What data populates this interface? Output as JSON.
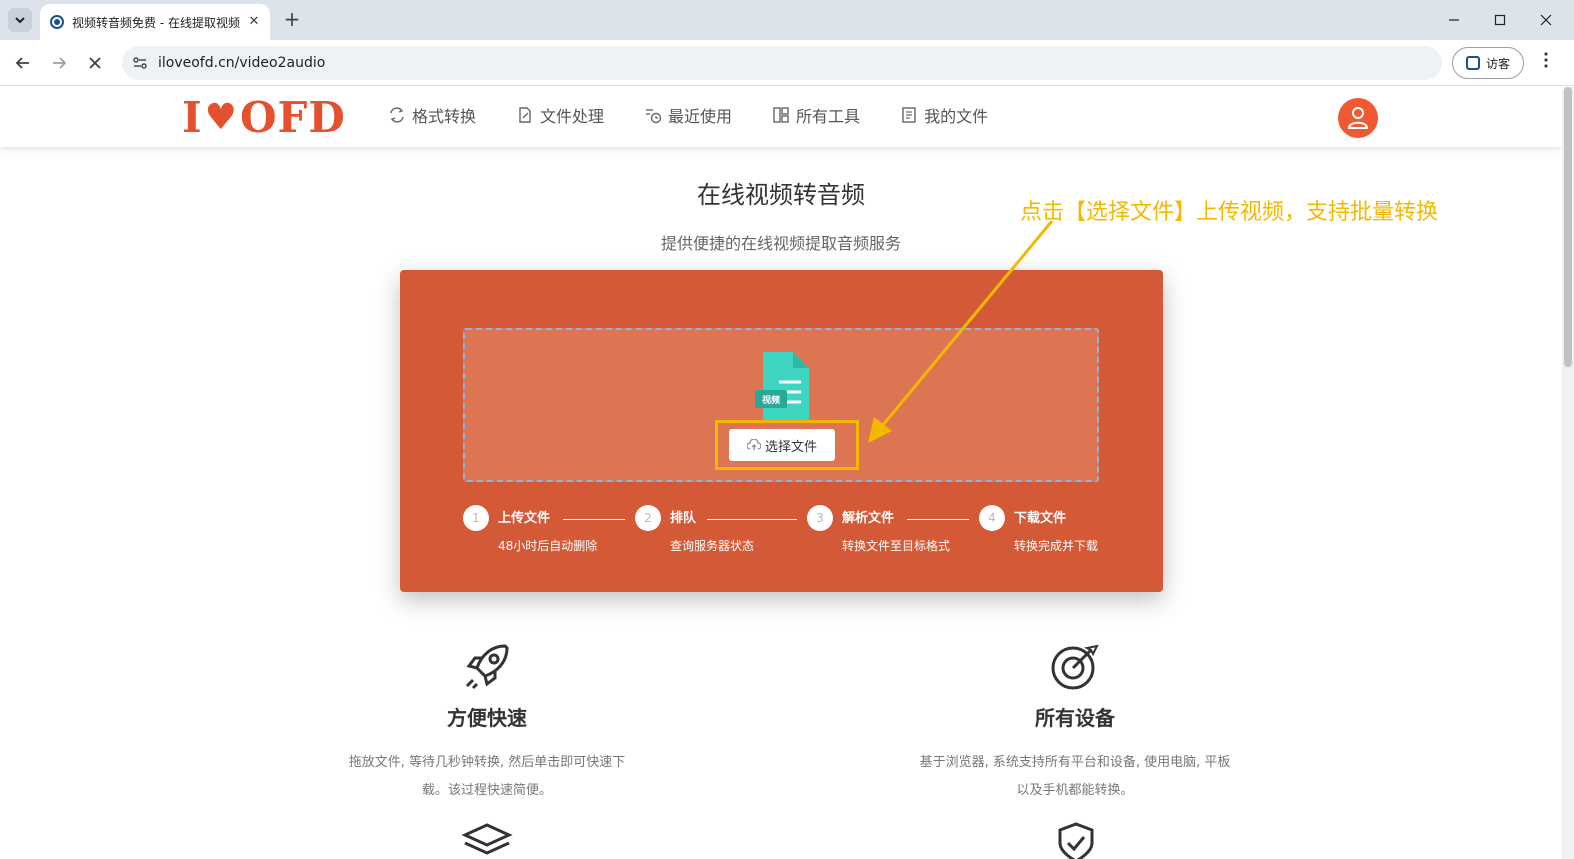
{
  "browser": {
    "tab_title": "视频转音频免费 - 在线提取视频",
    "url": "iloveofd.cn/video2audio",
    "guest_label": "访客"
  },
  "header": {
    "logo_left": "I",
    "logo_heart": "♥",
    "logo_right": "OFD",
    "nav": [
      {
        "label": "格式转换",
        "icon": "convert-icon"
      },
      {
        "label": "文件处理",
        "icon": "edit-file-icon"
      },
      {
        "label": "最近使用",
        "icon": "history-icon"
      },
      {
        "label": "所有工具",
        "icon": "grid-icon"
      },
      {
        "label": "我的文件",
        "icon": "document-icon"
      }
    ]
  },
  "hero": {
    "title": "在线视频转音频",
    "subtitle": "提供便捷的在线视频提取音频服务"
  },
  "annotation": {
    "text": "点击【选择文件】上传视频，支持批量转换",
    "color": "#f5b800"
  },
  "converter": {
    "file_badge": "视频",
    "select_button": "选择文件",
    "steps": [
      {
        "num": "1",
        "title": "上传文件",
        "desc": "48小时后自动删除"
      },
      {
        "num": "2",
        "title": "排队",
        "desc": "查询服务器状态"
      },
      {
        "num": "3",
        "title": "解析文件",
        "desc": "转换文件至目标格式"
      },
      {
        "num": "4",
        "title": "下载文件",
        "desc": "转换完成并下载"
      }
    ]
  },
  "features": [
    {
      "title": "方便快速",
      "desc": "拖放文件, 等待几秒钟转换, 然后单击即可快速下载。该过程快速简便。",
      "icon": "rocket-icon"
    },
    {
      "title": "所有设备",
      "desc": "基于浏览器, 系统支持所有平台和设备, 使用电脑, 平板以及手机都能转换。",
      "icon": "target-icon"
    }
  ],
  "colors": {
    "brand": "#e5502e",
    "panel": "#d45a37",
    "dropzone": "#dd7452",
    "file_icon": "#3ed6c0"
  }
}
